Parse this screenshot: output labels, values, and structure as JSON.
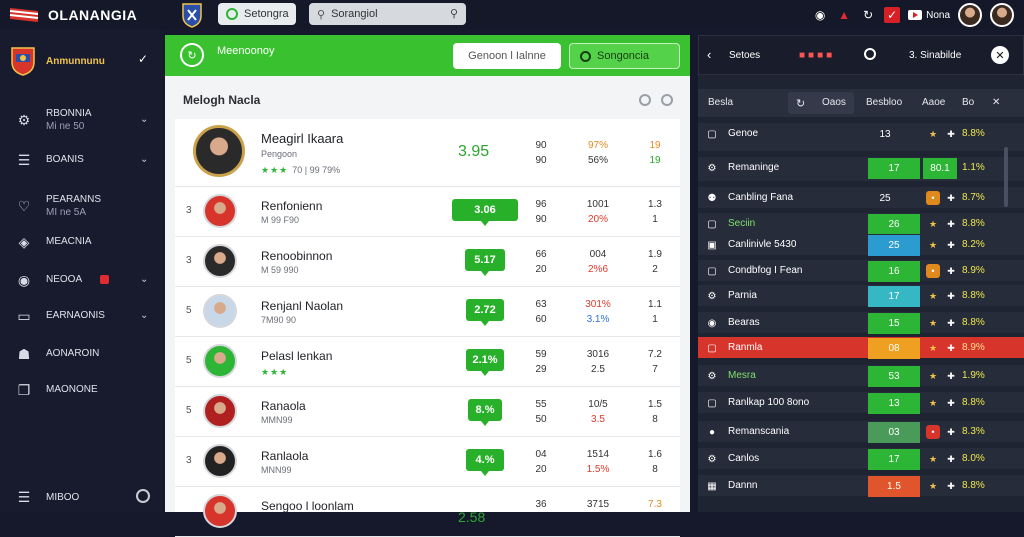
{
  "app": {
    "title": "OLANANGIA"
  },
  "topbar": {
    "pill_a": "Setongra",
    "pill_b": "Sorangiol",
    "user_label": "Nona"
  },
  "sidebar": {
    "team_name": "Anmunnunu",
    "items": [
      {
        "label": "RBONNIA",
        "sub": "Mi ne 50",
        "icon": "gear-icon",
        "chev": true
      },
      {
        "label": "BOANIS",
        "sub": "",
        "icon": "database-icon",
        "chev": true
      },
      {
        "label": "PEARANNS",
        "sub": "MI ne 5A",
        "icon": "heart-icon",
        "chev": false
      },
      {
        "label": "MEACNIA",
        "sub": "",
        "icon": "shield-icon",
        "chev": false
      },
      {
        "label": "NEOOA",
        "sub": "",
        "icon": "globe-icon",
        "chev": true,
        "badge": true
      },
      {
        "label": "EARNAONIS",
        "sub": "",
        "icon": "window-icon",
        "chev": true
      },
      {
        "label": "AONAROIN",
        "sub": "",
        "icon": "building-icon",
        "chev": false
      },
      {
        "label": "MAONONE",
        "sub": "",
        "icon": "copy-icon",
        "chev": false
      }
    ],
    "footer_label": "MIBOO"
  },
  "center": {
    "header_title": "Meenoonoy",
    "btn_search": "Genoon l Ialnne",
    "btn_active": "Songoncia",
    "subtitle": "Melogh Nacla",
    "rows": [
      {
        "rank": "",
        "name": "Meagirl Ikaara",
        "sub": "Pengoon",
        "sub2": "70 | 99 79%",
        "stars": true,
        "score": "3.95",
        "badge": false,
        "c1": [
          "90",
          "90"
        ],
        "c2": [
          "97%",
          "56%"
        ],
        "c2cls": [
          "org",
          "dk"
        ],
        "c3": [
          "19",
          "19"
        ],
        "c3cls": [
          "org",
          "grn"
        ],
        "big": true
      },
      {
        "rank": "3",
        "name": "Renfonienn",
        "sub": "M 99 F90",
        "stars": false,
        "score": "3.06",
        "badge": true,
        "c1": [
          "96",
          "90"
        ],
        "c2": [
          "1001",
          "20%"
        ],
        "c2cls": [
          "dk",
          "red"
        ],
        "c3": [
          "1.3",
          "1"
        ],
        "c3cls": [
          "dk",
          "dk"
        ]
      },
      {
        "rank": "3",
        "name": "Renoobinnon",
        "sub": "M 59 990",
        "stars": false,
        "score": "5.17",
        "badge": true,
        "c1": [
          "66",
          "20"
        ],
        "c2": [
          "004",
          "2%6"
        ],
        "c2cls": [
          "dk",
          "red"
        ],
        "c3": [
          "1.9",
          "2"
        ],
        "c3cls": [
          "dk",
          "dk"
        ]
      },
      {
        "rank": "5",
        "name": "Renjanl Naolan",
        "sub": "7M90 90",
        "stars": false,
        "score": "2.72",
        "badge": true,
        "c1": [
          "63",
          "60"
        ],
        "c2": [
          "301%",
          "3.1%"
        ],
        "c2cls": [
          "red",
          "blu"
        ],
        "c3": [
          "1.1",
          "1"
        ],
        "c3cls": [
          "dk",
          "dk"
        ]
      },
      {
        "rank": "5",
        "name": "Pelasl lenkan",
        "sub": "",
        "stars": true,
        "score": "2.1%",
        "badge": true,
        "c1": [
          "59",
          "29"
        ],
        "c2": [
          "3016",
          "2.5"
        ],
        "c2cls": [
          "dk",
          "dk"
        ],
        "c3": [
          "7.2",
          "7"
        ],
        "c3cls": [
          "dk",
          "dk"
        ]
      },
      {
        "rank": "5",
        "name": "Ranaola",
        "sub": "MMN99",
        "stars": false,
        "score": "8.%",
        "badge": true,
        "c1": [
          "55",
          "50"
        ],
        "c2": [
          "10/5",
          "3.5"
        ],
        "c2cls": [
          "dk",
          "red"
        ],
        "c3": [
          "1.5",
          "8"
        ],
        "c3cls": [
          "dk",
          "dk"
        ]
      },
      {
        "rank": "3",
        "name": "Ranlaola",
        "sub": "MNN99",
        "stars": false,
        "score": "4.%",
        "badge": true,
        "c1": [
          "04",
          "20"
        ],
        "c2": [
          "1514",
          "1.5%"
        ],
        "c2cls": [
          "dk",
          "red"
        ],
        "c3": [
          "1.6",
          "8"
        ],
        "c3cls": [
          "dk",
          "dk"
        ]
      },
      {
        "rank": "",
        "name": "Sengoo l loonlam",
        "sub": "",
        "stars": false,
        "score": "2.58",
        "badge": false,
        "c1": [
          "36",
          ""
        ],
        "c2": [
          "3715",
          ""
        ],
        "c2cls": [
          "dk",
          "dk"
        ],
        "c3": [
          "7.3",
          ""
        ],
        "c3cls": [
          "org",
          "dk"
        ]
      }
    ]
  },
  "right": {
    "title": "Setoes",
    "title2": "3. Sinabilde",
    "tabs": {
      "a": "Besla",
      "b": "Oaos",
      "c": "Besbloo",
      "d": "Aaoe",
      "e": "Bo"
    },
    "rows": [
      {
        "name": "Genoe",
        "v1": "13",
        "c1": "",
        "tail": "8.8%",
        "hl": false,
        "icon": "tag-icon"
      },
      {
        "name": "Remaninge",
        "v1": "17",
        "c1": "#2db535",
        "v2": "80.1",
        "c2": "#2db535",
        "tail": "1.1%",
        "hl": false,
        "icon": "gear-icon"
      },
      {
        "name": "Canbling Fana",
        "v1": "25",
        "c1": "",
        "tail": "8.7%",
        "hl": false,
        "icon": "trophy-icon",
        "sq": "#e08a1e"
      },
      {
        "name": "Seciin",
        "v1": "26",
        "c1": "#2db535",
        "tail": "8.8%",
        "hl": false,
        "icon": "tag-icon",
        "green": true
      },
      {
        "name": "Canlinivle 5430",
        "v1": "25",
        "c1": "#2b9bd0",
        "tail": "8.2%",
        "hl": false,
        "icon": "lock-icon"
      },
      {
        "name": "Condbfog I Fean",
        "v1": "16",
        "c1": "#2db535",
        "tail": "8.9%",
        "hl": false,
        "icon": "tag-icon",
        "sq": "#e08a1e"
      },
      {
        "name": "Parnia",
        "v1": "17",
        "c1": "#35b8c4",
        "tail": "8.8%",
        "hl": false,
        "icon": "gear-icon"
      },
      {
        "name": "Bearas",
        "v1": "15",
        "c1": "#2db535",
        "tail": "8.8%",
        "hl": false,
        "icon": "globe-icon"
      },
      {
        "name": "Ranmla",
        "v1": "08",
        "c1": "#f0a020",
        "tail": "8.9%",
        "hl": true,
        "icon": "tag-icon"
      },
      {
        "name": "Mesra",
        "v1": "53",
        "c1": "#2db535",
        "tail": "1.9%",
        "hl": false,
        "icon": "gear-icon",
        "green": true
      },
      {
        "name": "Ranlkap 100 8ono",
        "v1": "13",
        "c1": "#2db535",
        "tail": "8.8%",
        "hl": false,
        "icon": "tag-icon"
      },
      {
        "name": "Remanscania",
        "v1": "03",
        "c1": "#4a9a5a",
        "tail": "8.3%",
        "hl": false,
        "icon": "fire-icon",
        "sq": "#d7342c"
      },
      {
        "name": "Canlos",
        "v1": "17",
        "c1": "#2db535",
        "tail": "8.0%",
        "hl": false,
        "icon": "gear-icon"
      },
      {
        "name": "Dannn",
        "v1": "1.5",
        "c1": "#e0552b",
        "tail": "8.8%",
        "hl": false,
        "icon": "chart-icon"
      }
    ]
  }
}
